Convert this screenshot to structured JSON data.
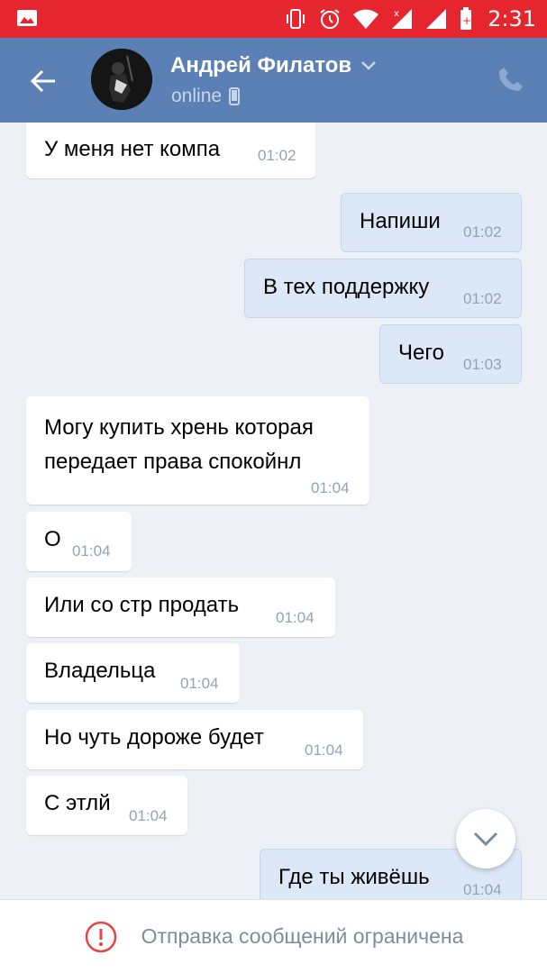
{
  "status_bar": {
    "time": "2:31",
    "icons": [
      "image-icon",
      "vibrate-icon",
      "alarm-icon",
      "wifi-icon",
      "signal-icon",
      "signal-icon",
      "battery-charging-icon"
    ]
  },
  "header": {
    "contact_name": "Андрей Филатов",
    "status": "online"
  },
  "messages": [
    {
      "direction": "in",
      "text": "У меня нет компа",
      "time": "01:02"
    },
    {
      "direction": "out",
      "text": "Напиши",
      "time": "01:02"
    },
    {
      "direction": "out",
      "text": "В тех поддержку",
      "time": "01:02"
    },
    {
      "direction": "out",
      "text": "Чего",
      "time": "01:03"
    },
    {
      "direction": "in",
      "text_lines": [
        "Могу купить хрень которая",
        "передает права спокойнл"
      ],
      "time": "01:04"
    },
    {
      "direction": "in",
      "text": "О",
      "time": "01:04"
    },
    {
      "direction": "in",
      "text": "Или со стр продать",
      "time": "01:04"
    },
    {
      "direction": "in",
      "text": "Владельца",
      "time": "01:04"
    },
    {
      "direction": "in",
      "text": "Но чуть дороже будет",
      "time": "01:04"
    },
    {
      "direction": "in",
      "text": "С этлй",
      "time": "01:04"
    },
    {
      "direction": "out",
      "text": "Где ты живёшь",
      "time": "01:04"
    }
  ],
  "bottom_bar": {
    "restriction_text": "Отправка сообщений ограничена"
  },
  "colors": {
    "status_bar": "#e6262f",
    "header": "#5b80b6",
    "chat_bg": "#edf0f5",
    "outgoing_bubble": "#dce8f8",
    "incoming_bubble": "#ffffff",
    "alert_red": "#e64646"
  }
}
